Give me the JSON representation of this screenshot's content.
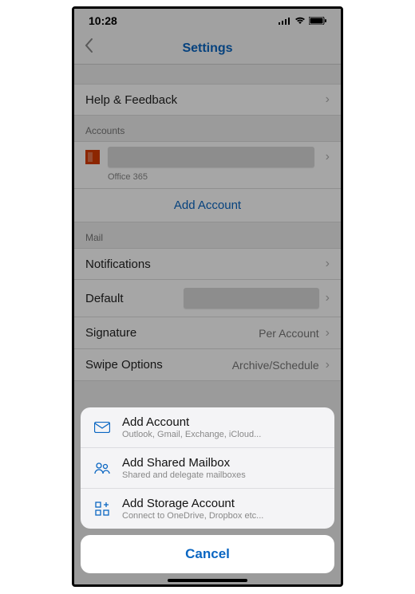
{
  "status": {
    "time": "10:28"
  },
  "nav": {
    "title": "Settings"
  },
  "rows": {
    "help": "Help & Feedback",
    "accounts_header": "Accounts",
    "account_type": "Office 365",
    "add_account": "Add Account",
    "mail_header": "Mail",
    "notifications": "Notifications",
    "default_label": "Default",
    "signature_label": "Signature",
    "signature_value": "Per Account",
    "swipe_label": "Swipe Options",
    "swipe_value": "Archive/Schedule"
  },
  "sheet": {
    "items": [
      {
        "title": "Add Account",
        "sub": "Outlook, Gmail, Exchange, iCloud..."
      },
      {
        "title": "Add Shared Mailbox",
        "sub": "Shared and delegate mailboxes"
      },
      {
        "title": "Add Storage Account",
        "sub": "Connect to OneDrive, Dropbox etc..."
      }
    ],
    "cancel": "Cancel"
  }
}
